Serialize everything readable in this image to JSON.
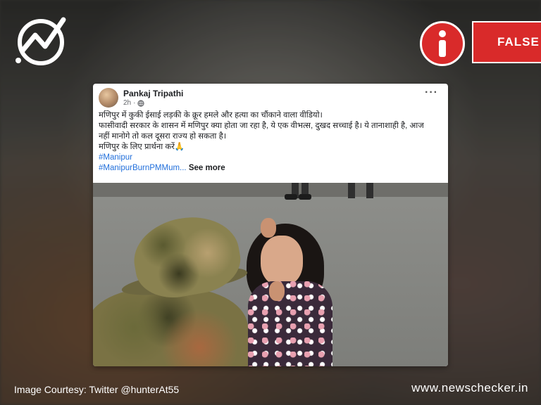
{
  "brand": {
    "logo_icon": "newschecker-logo-icon",
    "site": "www.newschecker.in"
  },
  "verdict": {
    "icon": "info-icon",
    "label": "FALSE",
    "color": "#d92a2a"
  },
  "post": {
    "author": "Pankaj Tripathi",
    "time": "2h",
    "privacy_icon": "globe-icon",
    "menu_icon": "more-dots-icon",
    "lines": [
      "मणिपुर में कुकी ईसाई लड़की के क्रूर हमले और हत्या का चौंकाने वाला वीडियो।",
      "फासीवादी सरकार के शासन में मणिपुर क्या होता जा रहा है, ये एक वीभत्स, दुखद सच्चाई है। ये तानाशाही है, आज",
      "नहीं मानोगे तो कल दूसरा राज्य हो सकता है।",
      "मणिपुर के लिए प्रार्थना करें🙏"
    ],
    "hashtag1": "#Manipur",
    "hashtag2": "#ManipurBurnPMMum...",
    "see_more": "See more"
  },
  "footer": {
    "credit": "Image Courtesy: Twitter @hunterAt55"
  }
}
